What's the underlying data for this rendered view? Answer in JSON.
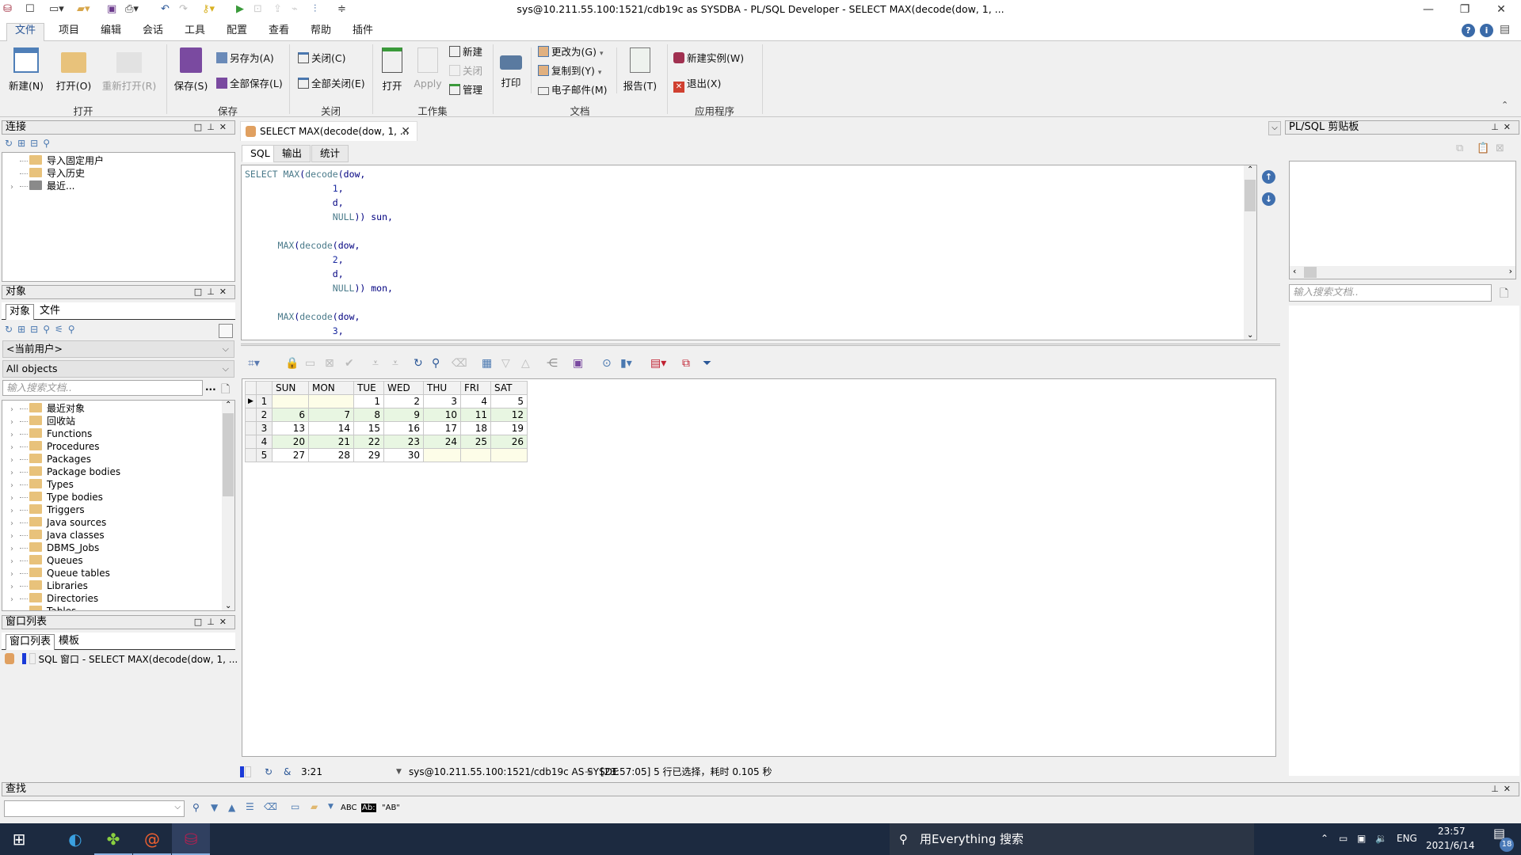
{
  "window": {
    "title": "sys@10.211.55.100:1521/cdb19c as SYSDBA - PL/SQL Developer - SELECT MAX(decode(dow, 1, ...",
    "minimize": "—",
    "restore": "❐",
    "close": "✕"
  },
  "menu": {
    "tabs": [
      "文件",
      "项目",
      "编辑",
      "会话",
      "工具",
      "配置",
      "查看",
      "帮助",
      "插件"
    ],
    "active": "文件",
    "help_icons": [
      "help-icon",
      "info-icon",
      "reader-icon"
    ]
  },
  "ribbon": {
    "open_group": {
      "label": "打开",
      "new": "新建(N)",
      "open": "打开(O)",
      "reopen": "重新打开(R)"
    },
    "save_group": {
      "label": "保存",
      "save": "保存(S)",
      "save_as": "另存为(A)",
      "save_all": "全部保存(L)"
    },
    "close_group": {
      "label": "关闭",
      "close": "关闭(C)",
      "close_all": "全部关闭(E)"
    },
    "workset_group": {
      "label": "工作集",
      "open": "打开",
      "apply": "Apply",
      "new": "新建",
      "close": "关闭",
      "manage": "管理"
    },
    "doc_group": {
      "label": "文档",
      "print": "打印",
      "change_to": "更改为(G)",
      "copy_to": "复制到(Y)",
      "email": "电子邮件(M)",
      "report": "报告(T)"
    },
    "app_group": {
      "label": "应用程序",
      "new_instance": "新建实例(W)",
      "exit": "退出(X)"
    }
  },
  "connections_panel": {
    "title": "连接",
    "items": [
      {
        "label": "导入固定用户",
        "expandable": false
      },
      {
        "label": "导入历史",
        "expandable": false
      },
      {
        "label": "最近...",
        "expandable": true
      }
    ]
  },
  "objects_panel": {
    "title": "对象",
    "tabs": [
      "对象",
      "文件"
    ],
    "user_select": "<当前用户>",
    "filter_select": "All objects",
    "search_placeholder": "输入搜索文档..",
    "more": "...",
    "items": [
      "最近对象",
      "回收站",
      "Functions",
      "Procedures",
      "Packages",
      "Package bodies",
      "Types",
      "Type bodies",
      "Triggers",
      "Java sources",
      "Java classes",
      "DBMS_Jobs",
      "Queues",
      "Queue tables",
      "Libraries",
      "Directories",
      "Tables"
    ]
  },
  "window_list_panel": {
    "title": "窗口列表",
    "tabs": [
      "窗口列表",
      "模板"
    ],
    "items": [
      "SQL 窗口 - SELECT MAX(decode(dow, 1, ..."
    ]
  },
  "document": {
    "tab_title": "SELECT MAX(decode(dow, 1, ...",
    "tabs": [
      "SQL",
      "输出",
      "统计"
    ],
    "active_tab": "SQL",
    "code_lines": [
      [
        {
          "t": "SELECT MAX",
          "c": "kw"
        },
        {
          "t": "(",
          "c": ""
        },
        {
          "t": "decode",
          "c": "kw"
        },
        {
          "t": "(dow,",
          "c": ""
        }
      ],
      [
        {
          "t": "                1",
          "c": "num"
        },
        {
          "t": ",",
          "c": ""
        }
      ],
      [
        {
          "t": "                d,",
          "c": ""
        }
      ],
      [
        {
          "t": "                NULL",
          "c": "kw"
        },
        {
          "t": ")) sun,",
          "c": ""
        }
      ],
      [
        {
          "t": "",
          "c": ""
        }
      ],
      [
        {
          "t": "      MAX",
          "c": "kw"
        },
        {
          "t": "(",
          "c": ""
        },
        {
          "t": "decode",
          "c": "kw"
        },
        {
          "t": "(dow,",
          "c": ""
        }
      ],
      [
        {
          "t": "                2",
          "c": "num"
        },
        {
          "t": ",",
          "c": ""
        }
      ],
      [
        {
          "t": "                d,",
          "c": ""
        }
      ],
      [
        {
          "t": "                NULL",
          "c": "kw"
        },
        {
          "t": ")) mon,",
          "c": ""
        }
      ],
      [
        {
          "t": "",
          "c": ""
        }
      ],
      [
        {
          "t": "      MAX",
          "c": "kw"
        },
        {
          "t": "(",
          "c": ""
        },
        {
          "t": "decode",
          "c": "kw"
        },
        {
          "t": "(dow,",
          "c": ""
        }
      ],
      [
        {
          "t": "                3",
          "c": "num"
        },
        {
          "t": ",",
          "c": ""
        }
      ]
    ]
  },
  "results": {
    "columns": [
      "SUN",
      "MON",
      "TUE",
      "WED",
      "THU",
      "FRI",
      "SAT"
    ],
    "rows": [
      [
        "",
        "",
        "1",
        "2",
        "3",
        "4",
        "5"
      ],
      [
        "6",
        "7",
        "8",
        "9",
        "10",
        "11",
        "12"
      ],
      [
        "13",
        "14",
        "15",
        "16",
        "17",
        "18",
        "19"
      ],
      [
        "20",
        "21",
        "22",
        "23",
        "24",
        "25",
        "26"
      ],
      [
        "27",
        "28",
        "29",
        "30",
        "",
        "",
        ""
      ]
    ],
    "current_row": 1
  },
  "status": {
    "position": "3:21",
    "amp": "&",
    "connection": "sys@10.211.55.100:1521/cdb19c AS SYSDE",
    "message": "[23:57:05]  5 行已选择，耗时 0.105 秒"
  },
  "clipboard_panel": {
    "title": "PL/SQL 剪贴板",
    "search_placeholder": "输入搜索文档.."
  },
  "find_bar": {
    "title": "查找",
    "value": "",
    "opts": [
      "ABC",
      "Ab:",
      "\"AB\""
    ]
  },
  "taskbar": {
    "search_placeholder": "用Everything 搜索",
    "lang": "ENG",
    "time": "23:57",
    "date": "2021/6/14",
    "notifications": "18"
  }
}
